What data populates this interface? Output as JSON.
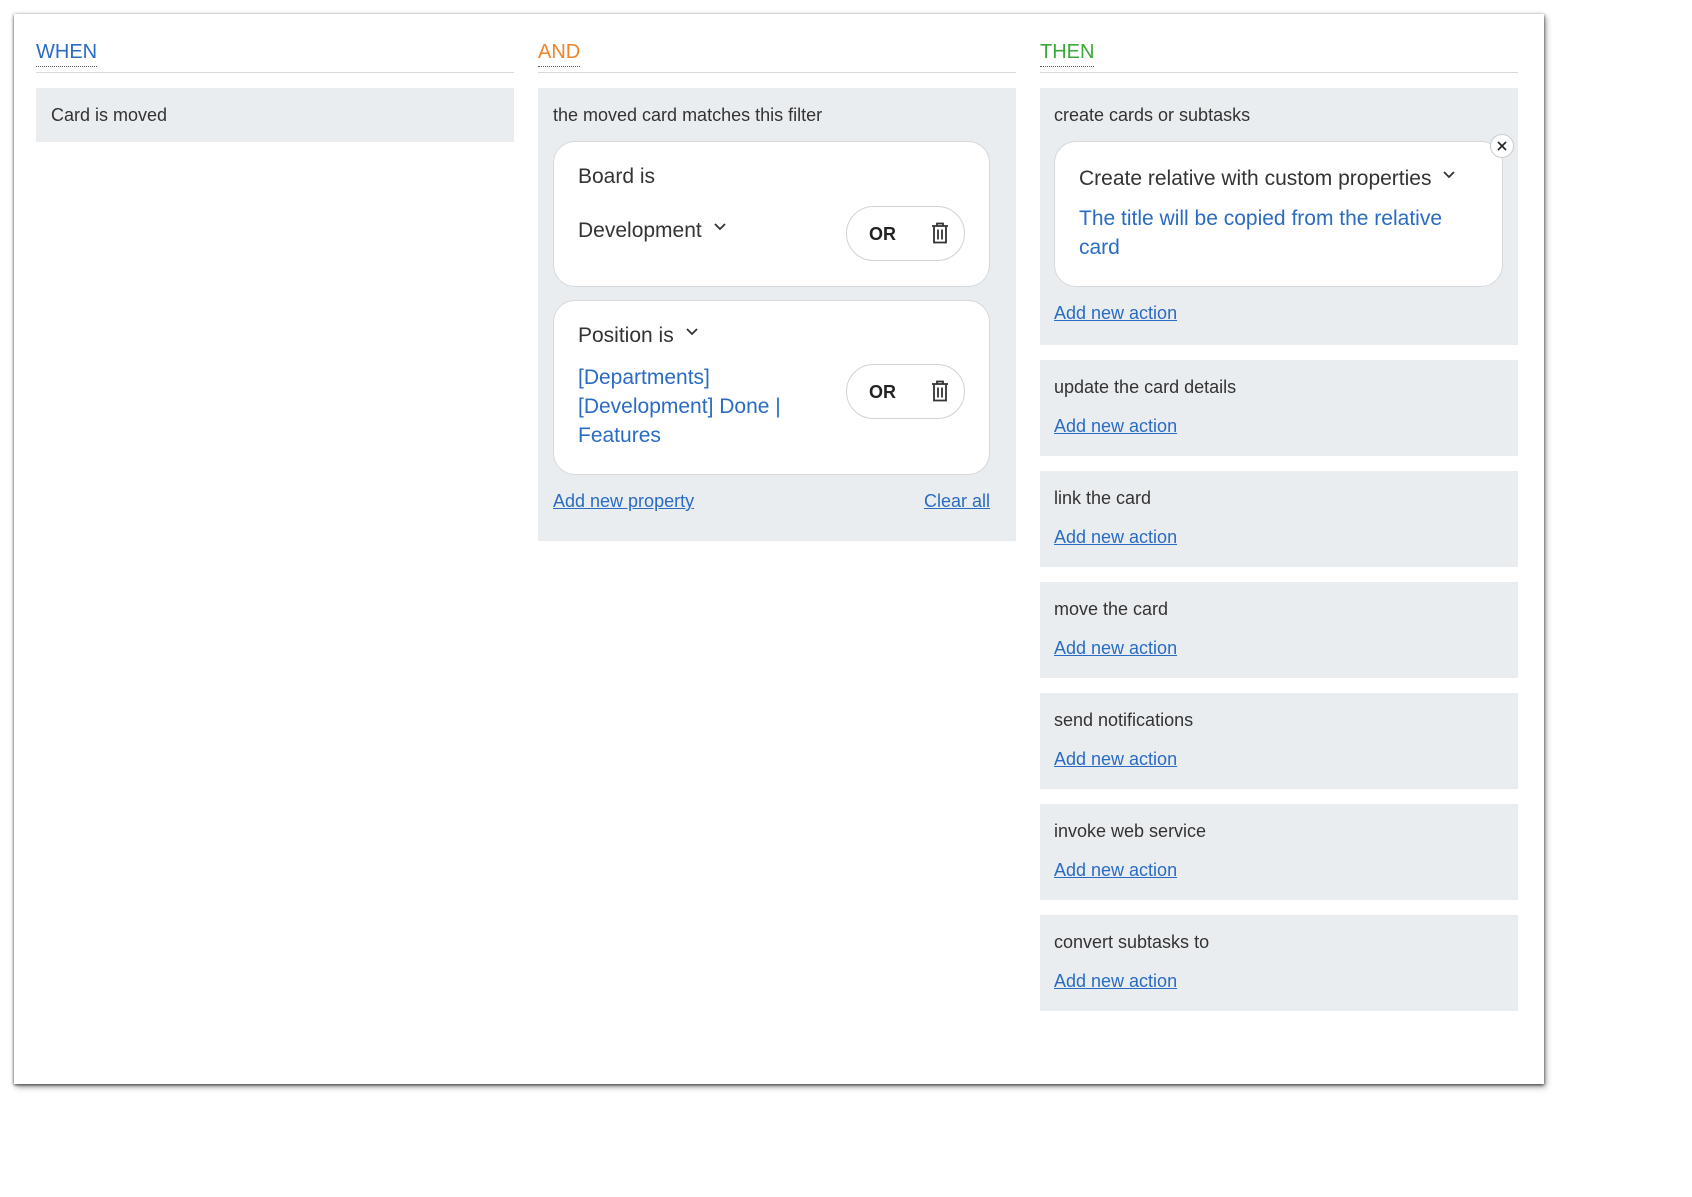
{
  "when": {
    "title": "WHEN",
    "trigger": "Card is moved"
  },
  "and": {
    "title": "AND",
    "panel_title": "the moved card matches this filter",
    "filters": [
      {
        "label": "Board is",
        "value": "Development",
        "or_label": "OR"
      },
      {
        "label": "Position is",
        "value": "[Departments] [Development] Done | Features",
        "or_label": "OR"
      }
    ],
    "add_property_label": "Add new property",
    "clear_all_label": "Clear all"
  },
  "then": {
    "title": "THEN",
    "groups": [
      {
        "title": "create cards or subtasks",
        "action_card": {
          "title": "Create relative with custom properties",
          "subtitle": "The title will be copied from the relative card"
        },
        "add_label": "Add new action"
      },
      {
        "title": "update the card details",
        "add_label": "Add new action"
      },
      {
        "title": "link the card",
        "add_label": "Add new action"
      },
      {
        "title": "move the card",
        "add_label": "Add new action"
      },
      {
        "title": "send notifications",
        "add_label": "Add new action"
      },
      {
        "title": "invoke web service",
        "add_label": "Add new action"
      },
      {
        "title": "convert subtasks to",
        "add_label": "Add new action"
      }
    ]
  },
  "icons": {
    "dropdown": "chevron-down-icon",
    "delete": "trash-icon",
    "remove": "close-icon"
  },
  "colors": {
    "when": "#2a6bc4",
    "and": "#f08428",
    "then": "#3aa83a",
    "link": "#2a6bc4",
    "panel_bg": "#eaedf0"
  }
}
